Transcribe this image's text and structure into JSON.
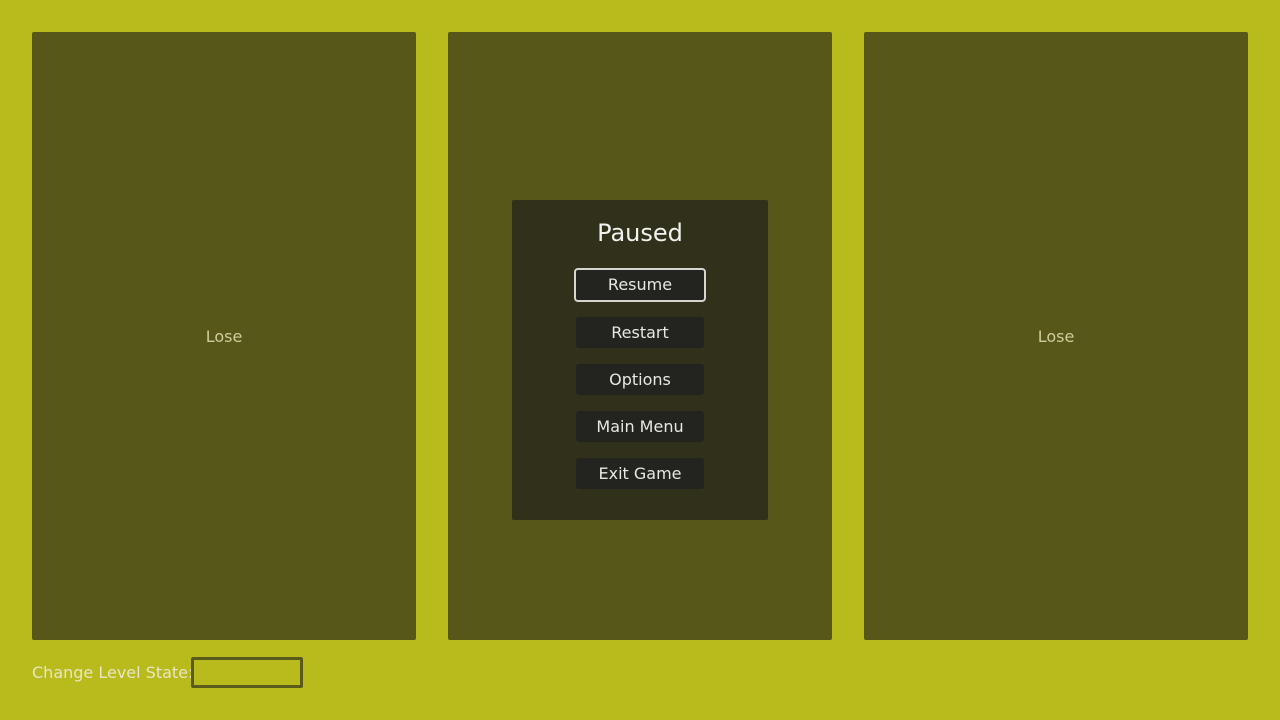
{
  "panels": {
    "left": {
      "label": "Lose"
    },
    "center": {
      "label": ""
    },
    "right": {
      "label": "Lose"
    }
  },
  "pause_menu": {
    "title": "Paused",
    "buttons": {
      "resume": "Resume",
      "restart": "Restart",
      "options": "Options",
      "main_menu": "Main Menu",
      "exit_game": "Exit Game"
    },
    "focused_button": "Resume"
  },
  "level_state": {
    "label": "Change Level State:",
    "value": ""
  },
  "colors": {
    "background": "#b8bb1b",
    "panel": "#58571a",
    "dialog": "#31311b",
    "button": "#232320",
    "focus_border": "#d6d6cf"
  }
}
